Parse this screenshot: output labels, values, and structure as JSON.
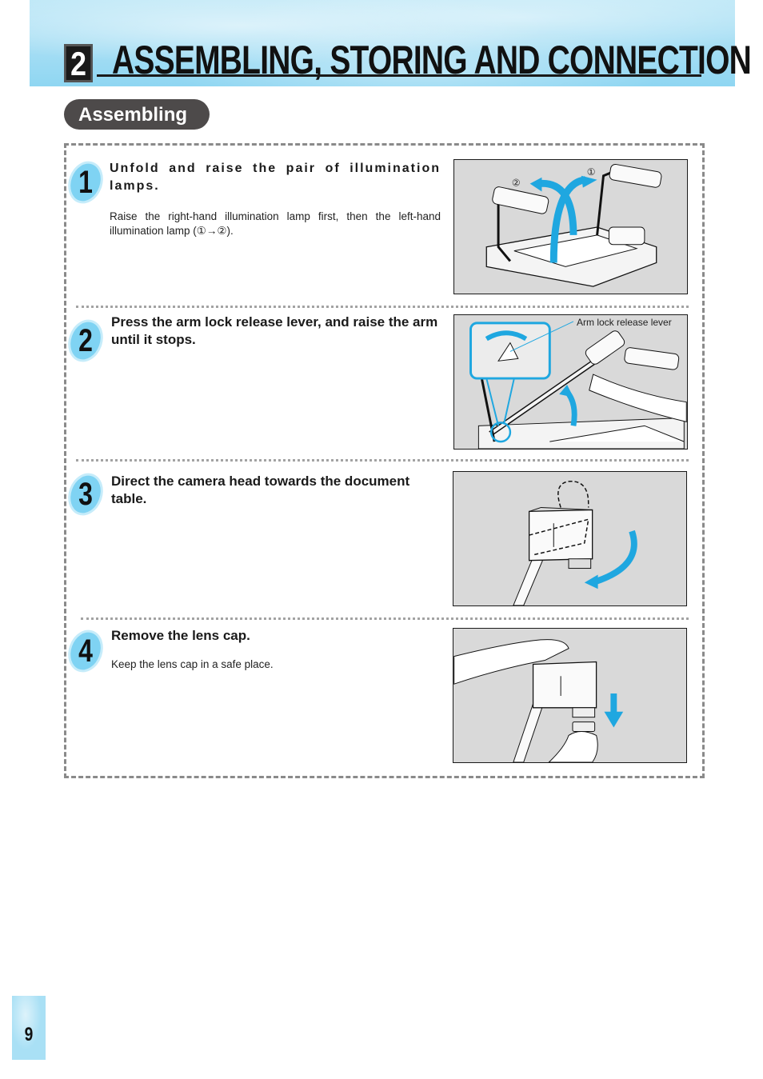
{
  "header": {
    "chapter_number": "2",
    "chapter_title": "ASSEMBLING, STORING AND CONNECTION"
  },
  "section": {
    "label": "Assembling"
  },
  "steps": [
    {
      "number": "1",
      "title": "Unfold and raise the pair of illumination lamps.",
      "description": "Raise the right-hand illumination lamp first, then the left-hand illumination lamp (①→②).",
      "illustration": {
        "subject": "visual presenter with two illumination lamps being raised",
        "markers": [
          "①",
          "②"
        ]
      }
    },
    {
      "number": "2",
      "title": "Press the arm lock release lever, and raise the arm until it stops.",
      "description": "",
      "illustration": {
        "subject": "hand raising camera arm with inset of lever",
        "callout": "Arm lock release lever"
      }
    },
    {
      "number": "3",
      "title": "Direct the camera head towards the document table.",
      "description": "",
      "illustration": {
        "subject": "camera head rotating downward"
      }
    },
    {
      "number": "4",
      "title": "Remove the lens cap.",
      "description": "Keep the lens cap in a safe place.",
      "illustration": {
        "subject": "hand removing lens cap from camera head"
      }
    }
  ],
  "footer": {
    "page_number": "9"
  },
  "colors": {
    "accent_blue": "#1fa7e0",
    "badge_blue": "#7fd3f3",
    "pill_gray": "#4d4a4a",
    "illus_bg": "#d9d9d9"
  }
}
